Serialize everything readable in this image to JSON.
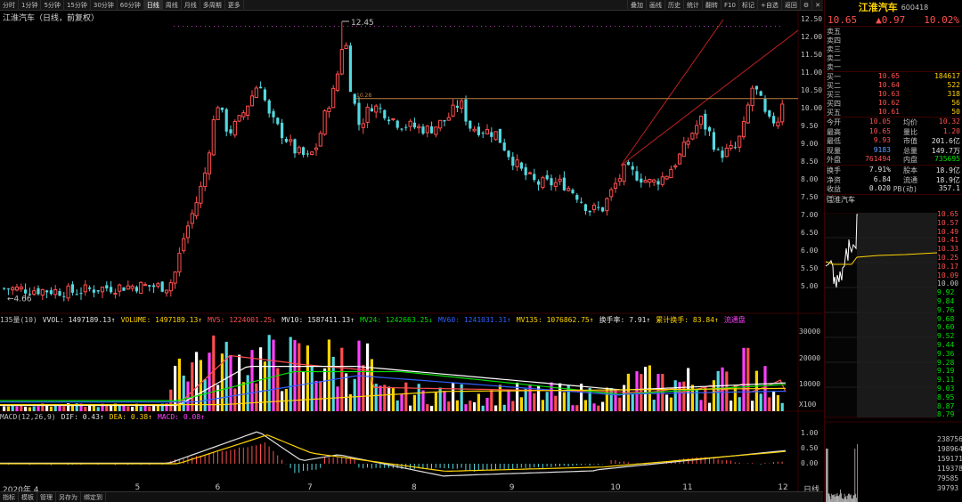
{
  "toolbar": {
    "periods": [
      "分时",
      "1分钟",
      "5分钟",
      "15分钟",
      "30分钟",
      "60分钟",
      "日线",
      "周线",
      "月线",
      "多周期",
      "更多"
    ],
    "active_period": "日线",
    "tools": [
      "叠加",
      "画线",
      "历史",
      "统计",
      "翻转",
      "F10",
      "标记",
      "+自选",
      "返回"
    ],
    "window_controls": [
      "⚙",
      "✕"
    ]
  },
  "chart_title": "江淮汽车（日线，前复权）",
  "price_axis": [
    "12.50",
    "12.00",
    "11.50",
    "11.00",
    "10.50",
    "10.00",
    "9.50",
    "9.00",
    "8.50",
    "8.00",
    "7.50",
    "7.00",
    "6.50",
    "6.00",
    "5.50",
    "5.00"
  ],
  "annotations": {
    "high": "12.45",
    "low": "4.66",
    "line_label": "10.28"
  },
  "volume_bar": {
    "prefix": "135量(10)",
    "items": [
      {
        "text": "VVOL: 1497189.13↑",
        "color": "#e0e0e0"
      },
      {
        "text": "VOLUME: 1497189.13↑",
        "color": "#ffd400"
      },
      {
        "text": "MV5: 1224001.25↓",
        "color": "#ff4f4f"
      },
      {
        "text": "MV10: 1587411.13↑",
        "color": "#e0e0e0"
      },
      {
        "text": "MV24: 1242663.25↓",
        "color": "#00e000"
      },
      {
        "text": "MV60: 1241031.31↑",
        "color": "#3060ff"
      },
      {
        "text": "MV135: 1076862.75↑",
        "color": "#ffd400"
      },
      {
        "text": "换手率: 7.91↑",
        "color": "#e0e0e0"
      },
      {
        "text": "累计换手: 83.84↑",
        "color": "#ffd400"
      },
      {
        "text": "流通盘",
        "color": "#ff40ff"
      }
    ]
  },
  "volume_axis": [
    "30000",
    "20000",
    "10000",
    "X100"
  ],
  "macd_bar": {
    "items": [
      {
        "text": "MACD(12,26,9)",
        "color": "#c0c0c0"
      },
      {
        "text": "DIF: 0.43↑",
        "color": "#e0e0e0"
      },
      {
        "text": "DEA: 0.38↑",
        "color": "#ffd400"
      },
      {
        "text": "MACD: 0.08↑",
        "color": "#ff40ff"
      }
    ]
  },
  "macd_axis": [
    "1.00",
    "0.50",
    "0.00"
  ],
  "x_axis": [
    {
      "label": "2020年 4",
      "pos": 0.0
    },
    {
      "label": "5",
      "pos": 0.165
    },
    {
      "label": "6",
      "pos": 0.265
    },
    {
      "label": "7",
      "pos": 0.38
    },
    {
      "label": "8",
      "pos": 0.51
    },
    {
      "label": "9",
      "pos": 0.632
    },
    {
      "label": "10",
      "pos": 0.758
    },
    {
      "label": "11",
      "pos": 0.848
    },
    {
      "label": "12",
      "pos": 0.967
    }
  ],
  "bottom_tabs": [
    "指标",
    "模板",
    "管理",
    "另存为",
    "绑定到"
  ],
  "quote": {
    "name": "江淮汽车",
    "code": "600418",
    "price": "10.65",
    "change": "▲0.97",
    "pct": "10.02%",
    "asks": [
      {
        "label": "卖五",
        "price": "",
        "vol": ""
      },
      {
        "label": "卖四",
        "price": "",
        "vol": ""
      },
      {
        "label": "卖三",
        "price": "",
        "vol": ""
      },
      {
        "label": "卖二",
        "price": "",
        "vol": ""
      },
      {
        "label": "卖一",
        "price": "",
        "vol": ""
      }
    ],
    "bids": [
      {
        "label": "买一",
        "price": "10.65",
        "vol": "184617"
      },
      {
        "label": "买二",
        "price": "10.64",
        "vol": "522"
      },
      {
        "label": "买三",
        "price": "10.63",
        "vol": "318"
      },
      {
        "label": "买四",
        "price": "10.62",
        "vol": "56"
      },
      {
        "label": "买五",
        "price": "10.61",
        "vol": "50"
      }
    ],
    "stats": [
      {
        "l1": "今开",
        "v1": "10.05",
        "c1": "red",
        "l2": "均价",
        "v2": "10.32",
        "c2": "red"
      },
      {
        "l1": "最高",
        "v1": "10.65",
        "c1": "red",
        "l2": "量比",
        "v2": "1.20",
        "c2": "red"
      },
      {
        "l1": "最低",
        "v1": "9.93",
        "c1": "red",
        "l2": "市值",
        "v2": "201.6亿",
        "c2": "wht"
      },
      {
        "l1": "现量",
        "v1": "9183",
        "c1": "blu",
        "l2": "总量",
        "v2": "149.7万",
        "c2": "wht"
      },
      {
        "l1": "外盘",
        "v1": "761494",
        "c1": "red",
        "l2": "内盘",
        "v2": "735695",
        "c2": "grn"
      }
    ],
    "stats2": [
      {
        "l1": "换手",
        "v1": "7.91%",
        "c1": "wht",
        "l2": "股本",
        "v2": "18.9亿",
        "c2": "wht"
      },
      {
        "l1": "净资",
        "v1": "6.84",
        "c1": "wht",
        "l2": "流通",
        "v2": "18.9亿",
        "c2": "wht"
      },
      {
        "l1": "收益㈢",
        "v1": "0.020",
        "c1": "wht",
        "l2": "PB(动)",
        "v2": "357.1",
        "c2": "wht"
      }
    ],
    "mini_title": "江淮汽车",
    "mini_axis": [
      "10.65",
      "10.57",
      "10.49",
      "10.41",
      "10.33",
      "10.25",
      "10.17",
      "10.09",
      "10.00",
      "9.92",
      "9.84",
      "9.76",
      "9.68",
      "9.60",
      "9.52",
      "9.44",
      "9.36",
      "9.28",
      "9.19",
      "9.11",
      "9.03",
      "8.95",
      "8.87",
      "8.79"
    ],
    "mini_vol_axis": [
      "238756",
      "198964",
      "159171",
      "119378",
      "79585",
      "39793"
    ]
  },
  "colors": {
    "up": "#ff4f4f",
    "down": "#54d8e0",
    "ma5": "#ffffff",
    "ma10": "#ffd400",
    "ma20": "#ff40ff",
    "ma60": "#00e000"
  }
}
